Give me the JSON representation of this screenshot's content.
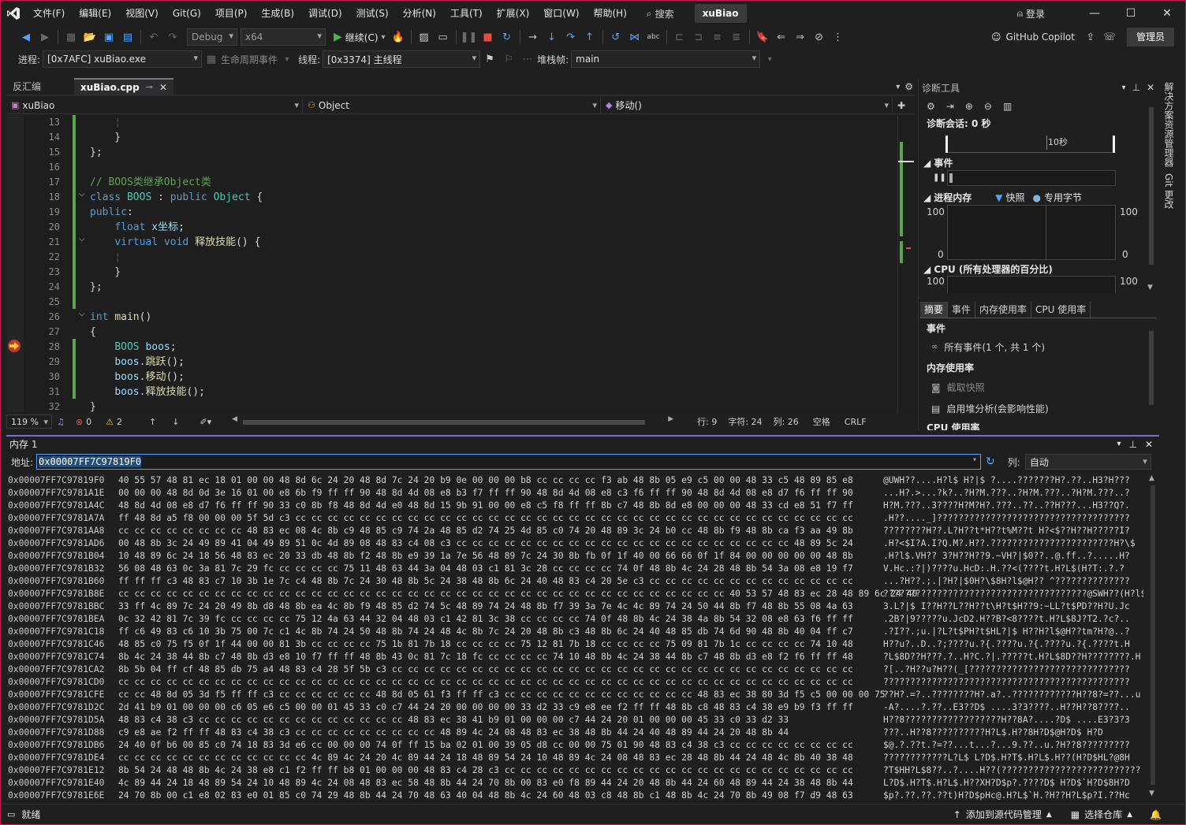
{
  "titlebar": {
    "menus": [
      "文件(F)",
      "编辑(E)",
      "视图(V)",
      "Git(G)",
      "项目(P)",
      "生成(B)",
      "调试(D)",
      "测试(S)",
      "分析(N)",
      "工具(T)",
      "扩展(X)",
      "窗口(W)",
      "帮助(H)"
    ],
    "search_label": "搜索",
    "project_name": "xuBiao",
    "login_label": "登录"
  },
  "toolbar": {
    "config": "Debug",
    "platform": "x64",
    "continue_label": "继续(C)",
    "copilot_label": "GitHub Copilot",
    "admin_label": "管理员"
  },
  "debugbar": {
    "process_label": "进程:",
    "process_value": "[0x7AFC] xuBiao.exe",
    "lifecycle_label": "生命周期事件",
    "thread_label": "线程:",
    "thread_value": "[0x3374] 主线程",
    "stack_label": "堆栈帧:",
    "stack_value": "main"
  },
  "editor": {
    "tabs": [
      {
        "label": "反汇编"
      },
      {
        "label": "xuBiao.cpp"
      }
    ],
    "nav": {
      "project": "xuBiao",
      "scope": "Object",
      "member": "移动()"
    },
    "line_numbers": [
      "13",
      "14",
      "15",
      "16",
      "17",
      "18",
      "19",
      "20",
      "21",
      "22",
      "23",
      "24",
      "25",
      "26",
      "27",
      "28",
      "29",
      "30",
      "31",
      "32"
    ],
    "status": {
      "zoom": "119 %",
      "errors": "0",
      "warnings": "2",
      "line": "行: 9",
      "char": "字符: 24",
      "col": "列: 26",
      "space": "空格",
      "eol": "CRLF"
    }
  },
  "diag": {
    "title": "诊断工具",
    "session": "诊断会话: 0 秒",
    "timeline_label": "10秒",
    "events_h": "事件",
    "mem_h": "进程内存",
    "snapshot_legend": "快照",
    "private_legend": "专用字节",
    "mem_max_l": "100",
    "mem_max_r": "100",
    "mem_min_l": "0",
    "mem_min_r": "0",
    "cpu_h": "CPU (所有处理器的百分比)",
    "cpu_max_l": "100",
    "cpu_max_r": "100",
    "tabs": [
      "摘要",
      "事件",
      "内存使用率",
      "CPU 使用率"
    ],
    "summary_events_h": "事件",
    "all_events": "所有事件(1 个, 共 1 个)",
    "mem_usage_h": "内存使用率",
    "take_snapshot": "截取快照",
    "heap_analysis": "启用堆分析(会影响性能)",
    "cpu_usage_h": "CPU 使用率"
  },
  "siderail": {
    "items": [
      "解决方案资源管理器",
      "Git 更改"
    ]
  },
  "memory": {
    "title": "内存 1",
    "addr_label": "地址:",
    "addr_value": "0x00007FF7C97819F0",
    "col_label": "列:",
    "col_value": "自动",
    "rows": [
      [
        "0x00007FF7C97819F0",
        "40 55 57 48 81 ec 18 01 00 00 48 8d 6c 24 20 48 8d 7c 24 20 b9 0e 00 00 00 b8 cc cc cc cc f3 ab 48 8b 05 e9 c5 00 00 48 33 c5 48 89 85 e8",
        "@UWH??....H?l$ H?|$ ?....???????H?.??..H3?H???"
      ],
      [
        "0x00007FF7C9781A1E",
        "00 00 00 48 8d 0d 3e 16 01 00 e8 6b f9 ff ff 90 48 8d 4d 08 e8 b3 f7 ff ff 90 48 8d 4d 08 e8 c3 f6 ff ff 90 48 8d 4d 08 e8 d7 f6 ff ff 90",
        "...H?.>...?k?..?H?M.???..?H?M.???..?H?M.???..?"
      ],
      [
        "0x00007FF7C9781A4C",
        "48 8d 4d 08 e8 d7 f6 ff ff 90 33 c0 8b f8 48 8d 4d e0 48 8d 15 9b 91 00 00 e8 c5 f8 ff ff 8b c7 48 8b 8d e8 00 00 00 48 33 cd e8 51 f7 ff",
        "H?M.???..3????H?M?H?.???..??..??H???...H3??Q?."
      ],
      [
        "0x00007FF7C9781A7A",
        "ff 48 8d a5 f8 00 00 00 5f 5d c3 cc cc cc cc cc cc cc cc cc cc cc cc cc cc cc cc cc cc cc cc cc cc cc cc cc cc cc cc cc cc cc cc cc cc cc",
        ".H??...._]????????????????????????????????????"
      ],
      [
        "0x00007FF7C9781AA8",
        "cc cc cc cc cc cc cc cc 48 83 ec 08 4c 8b c9 48 85 c9 74 2a 48 85 d2 74 25 4d 85 c0 74 20 48 89 3c 24 b0 cc 48 8b f9 48 8b ca f3 aa 49 8b",
        "????????H??.L?H??t*H??t%M??t H?<$??H??H?????I?"
      ],
      [
        "0x00007FF7C9781AD6",
        "00 48 8b 3c 24 49 89 41 04 49 89 51 0c 4d 89 08 48 83 c4 08 c3 cc cc cc cc cc cc cc cc cc cc cc cc cc cc cc cc cc cc cc cc cc 48 89 5c 24",
        ".H?<$I?A.I?Q.M?.H??.???????????????????????H?\\$"
      ],
      [
        "0x00007FF7C9781B04",
        "10 48 89 6c 24 18 56 48 83 ec 20 33 db 48 8b f2 48 8b e9 39 1a 7e 56 48 89 7c 24 30 8b fb 0f 1f 40 00 66 66 0f 1f 84 00 00 00 00 00 48 8b",
        ".H?l$.VH?? 3?H??H??9.~VH?|$0??..@.ff..?.....H?"
      ],
      [
        "0x00007FF7C9781B32",
        "56 08 48 63 0c 3a 81 7c 29 fc cc cc cc cc 75 11 48 63 44 3a 04 48 03 c1 81 3c 28 cc cc cc cc 74 0f 48 8b 4c 24 28 48 8b 54 3a 08 e8 19 f7",
        "V.Hc.:?|)????u.HcD:.H.??<(????t.H?L$(H?T:.?.?"
      ],
      [
        "0x00007FF7C9781B60",
        "ff ff ff c3 48 83 c7 10 3b 1e 7c c4 48 8b 7c 24 30 48 8b 5c 24 38 48 8b 6c 24 40 48 83 c4 20 5e c3 cc cc cc cc cc cc cc cc cc cc cc cc cc",
        "...?H??.;.|?H?|$0H?\\$8H?l$@H?? ^??????????????"
      ],
      [
        "0x00007FF7C9781B8E",
        "cc cc cc cc cc cc cc cc cc cc cc cc cc cc cc cc cc cc cc cc cc cc cc cc cc cc cc cc cc cc cc cc cc cc cc cc cc cc 40 53 57 48 83 ec 28 48 89 6c 24 40",
        "??????????????????????????????????????@SWH??(H?l$@"
      ],
      [
        "0x00007FF7C9781BBC",
        "33 ff 4c 89 7c 24 20 49 8b d8 48 8b ea 4c 8b f9 48 85 d2 74 5c 48 89 74 24 48 8b f7 39 3a 7e 4c 4c 89 74 24 50 44 8b f7 48 8b 55 08 4a 63",
        "3.L?|$ I??H??L??H??t\\H?t$H??9:~LL?t$PD??H?U.Jc"
      ],
      [
        "0x00007FF7C9781BEA",
        "0c 32 42 81 7c 39 fc cc cc cc cc 75 12 4a 63 44 32 04 48 03 c1 42 81 3c 38 cc cc cc cc 74 0f 48 8b 4c 24 38 4a 8b 54 32 08 e8 63 f6 ff ff",
        ".2B?|9?????u.JcD2.H??B?<8????t.H?L$8J?T2.?c?.."
      ],
      [
        "0x00007FF7C9781C18",
        "ff c6 49 83 c6 10 3b 75 00 7c c1 4c 8b 74 24 50 48 8b 74 24 48 4c 8b 7c 24 20 48 8b c3 48 8b 6c 24 40 48 85 db 74 6d 90 48 8b 40 04 ff c7",
        ".?I??.;u.|?L?t$PH?t$HL?|$ H??H?l$@H??tm?H?@..?"
      ],
      [
        "0x00007FF7C9781C46",
        "48 85 c0 75 f5 0f 1f 44 00 00 81 3b cc cc cc cc 75 1b 81 7b 18 cc cc cc cc 75 12 81 7b 18 cc cc cc cc 75 09 81 7b 1c cc cc cc cc 74 10 48",
        "H??u?..D..?;????u.?{.????u.?{.????u.?{.????t.H"
      ],
      [
        "0x00007FF7C9781C74",
        "8b 4c 24 38 44 8b c7 48 8b d3 e8 10 f7 ff ff 48 8b 43 0c 81 7c 18 fc cc cc cc cc 74 10 48 8b 4c 24 38 44 8b c7 48 8b d3 e8 f2 f6 ff ff 48",
        "?L$8D??H???.?..H?C.?|.?????t.H?L$8D??H????????.H"
      ],
      [
        "0x00007FF7C9781CA2",
        "8b 5b 04 ff cf 48 85 db 75 a4 48 83 c4 28 5f 5b c3 cc cc cc cc cc cc cc cc cc cc cc cc cc cc cc cc cc cc cc cc cc cc cc cc cc cc cc cc cc",
        "?[..?H??u?H??(_[??????????????????????????????"
      ],
      [
        "0x00007FF7C9781CD0",
        "cc cc cc cc cc cc cc cc cc cc cc cc cc cc cc cc cc cc cc cc cc cc cc cc cc cc cc cc cc cc cc cc cc cc cc cc cc cc cc cc cc cc cc cc cc cc",
        "??????????????????????????????????????????????"
      ],
      [
        "0x00007FF7C9781CFE",
        "cc cc 48 8d 05 3d f5 ff ff c3 cc cc cc cc cc cc 48 8d 05 61 f3 ff ff c3 cc cc cc cc cc cc cc cc cc cc cc cc 48 83 ec 38 80 3d f5 c5 00 00 00 75",
        "??H?.=?..????????H?.a?..????????????H??8?=??...u"
      ],
      [
        "0x00007FF7C9781D2C",
        "2d 41 b9 01 00 00 00 c6 05 e6 c5 00 00 01 45 33 c0 c7 44 24 20 00 00 00 00 33 d2 33 c9 e8 ee f2 ff ff 48 8b c8 48 83 c4 38 e9 b9 f3 ff ff",
        "-A?....?.??..E3??D$ ....3?3????..H??H??8????.."
      ],
      [
        "0x00007FF7C9781D5A",
        "48 83 c4 38 c3 cc cc cc cc cc cc cc cc cc cc cc cc cc 48 83 ec 38 41 b9 01 00 00 00 c7 44 24 20 01 00 00 00 45 33 c0 33 d2 33",
        "H??8??????????????????H??8A?....?D$ ....E3?3?3"
      ],
      [
        "0x00007FF7C9781D88",
        "c9 e8 ae f2 ff ff 48 83 c4 38 c3 cc cc cc cc cc cc cc cc cc 48 89 4c 24 08 48 83 ec 38 48 8b 44 24 40 48 89 44 24 20 48 8b 44",
        "???..H??8??????????H?L$.H??8H?D$@H?D$ H?D"
      ],
      [
        "0x00007FF7C9781DB6",
        "24 40 0f b6 00 85 c0 74 18 83 3d e6 cc 00 00 00 74 0f ff 15 ba 02 01 00 39 05 d8 cc 00 00 75 01 90 48 83 c4 38 c3 cc cc cc cc cc cc cc cc",
        "$@.?.??t.?=??...t...?...9.??..u.?H??8?????????"
      ],
      [
        "0x00007FF7C9781DE4",
        "cc cc cc cc cc cc cc cc cc cc cc cc 4c 89 4c 24 20 4c 89 44 24 18 48 89 54 24 10 48 89 4c 24 08 48 83 ec 28 48 8b 44 24 48 4c 8b 40 38 48",
        "????????????L?L$ L?D$.H?T$.H?L$.H??(H?D$HL?@8H"
      ],
      [
        "0x00007FF7C9781E12",
        "8b 54 24 48 48 8b 4c 24 38 e8 c1 f2 ff ff b8 01 00 00 00 48 83 c4 28 c3 cc cc cc cc cc cc cc cc cc cc cc cc cc cc cc cc cc cc cc cc cc cc",
        "?T$HH?L$8??..?....H??(??????????????????????????"
      ],
      [
        "0x00007FF7C9781E40",
        "4c 89 44 24 18 48 89 54 24 10 48 89 4c 24 08 48 83 ec 58 48 8b 44 24 70 8b 00 83 e0 f8 89 44 24 20 48 8b 44 24 60 48 89 44 24 38 48 8b 44",
        "L?D$.H?T$.H?L$.H??XH?D$p?.????D$ H?D$`H?D$8H?D"
      ],
      [
        "0x00007FF7C9781E6E",
        "24 70 8b 00 c1 e8 02 83 e0 01 85 c0 74 29 48 8b 44 24 70 48 63 40 04 48 8b 4c 24 60 48 03 c8 48 8b c1 48 8b 4c 24 70 8b 49 08 f7 d9 48 63",
        "$p?.??.??.??t)H?D$pHc@.H?L$`H.?H??H?L$p?I.??Hc"
      ]
    ]
  },
  "statusbar": {
    "ready": "就绪",
    "add_source": "添加到源代码管理",
    "select_repo": "选择仓库"
  }
}
